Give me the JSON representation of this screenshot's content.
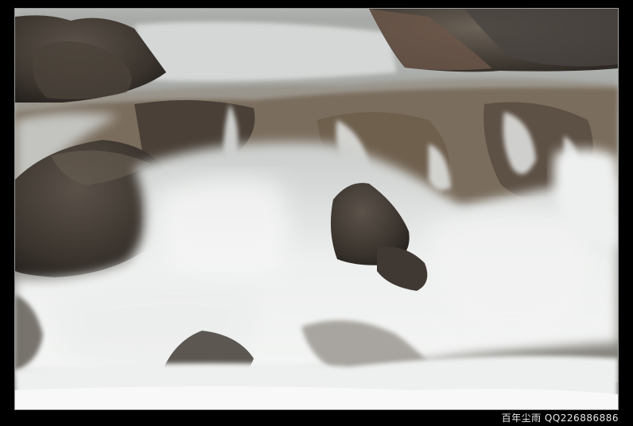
{
  "watermark": {
    "text": "百年尘雨 QQ226886886"
  },
  "photo": {
    "subject": "waterfall-over-rocks"
  },
  "colors": {
    "border": "#000000",
    "frame_line": "#9a9a9a",
    "water": "#e6e8e8",
    "rock": "#3b3530"
  }
}
